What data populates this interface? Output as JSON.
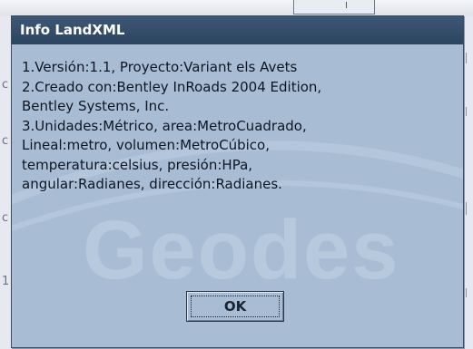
{
  "dialog": {
    "title": "Info LandXML",
    "lines": [
      "1.Versión:1.1, Proyecto:Variant els Avets",
      "2.Creado con:Bentley InRoads 2004 Edition,",
      "Bentley Systems, Inc.",
      "3.Unidades:Métrico, area:MetroCuadrado,",
      "Lineal:metro, volumen:MetroCúbico,",
      "temperatura:celsius, presión:HPa,",
      "angular:Radianes, dirección:Radianes."
    ],
    "ok_label": "OK",
    "watermark_text": "Geodes"
  },
  "background": {
    "left_glyphs": [
      "c",
      "c",
      "c",
      "1"
    ]
  },
  "colors": {
    "titlebar": "#2c4460",
    "dialog_body": "#a8bdd4",
    "title_text": "#ffffff",
    "body_text": "#0f1622"
  }
}
